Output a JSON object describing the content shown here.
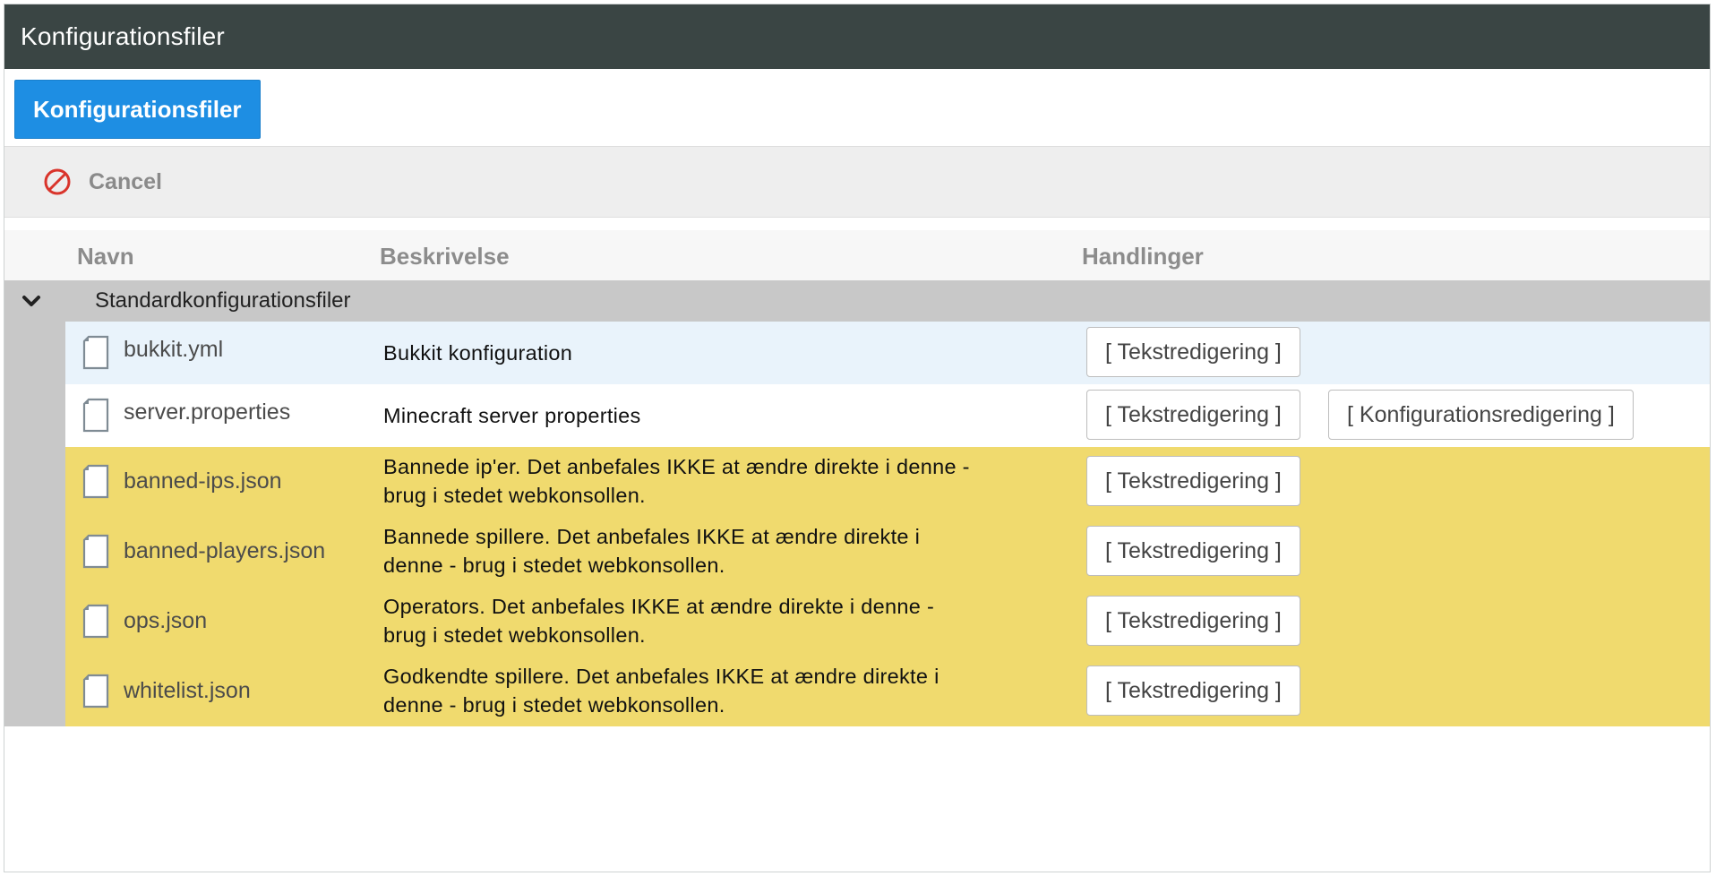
{
  "window": {
    "title": "Konfigurationsfiler"
  },
  "tab": {
    "label": "Konfigurationsfiler"
  },
  "toolbar": {
    "cancel_label": "Cancel"
  },
  "table": {
    "headers": {
      "name": "Navn",
      "description": "Beskrivelse",
      "actions": "Handlinger"
    },
    "group": {
      "label": "Standardkonfigurationsfiler",
      "rows": [
        {
          "name": "bukkit.yml",
          "description": "Bukkit konfiguration",
          "actions": [
            "[ Tekstredigering ]"
          ]
        },
        {
          "name": "server.properties",
          "description": "Minecraft server properties",
          "actions": [
            "[ Tekstredigering ]",
            "[ Konfigurationsredigering ]"
          ]
        },
        {
          "name": "banned-ips.json",
          "description_line1": "Bannede ip'er. Det anbefales IKKE at ændre direkte i denne -",
          "description_line2": "brug i stedet webkonsollen.",
          "actions": [
            "[ Tekstredigering ]"
          ]
        },
        {
          "name": "banned-players.json",
          "description_line1": "Bannede spillere. Det anbefales IKKE at ændre direkte i",
          "description_line2": "denne - brug i stedet webkonsollen.",
          "actions": [
            "[ Tekstredigering ]"
          ]
        },
        {
          "name": "ops.json",
          "description_line1": "Operators. Det anbefales IKKE at ændre direkte i denne -",
          "description_line2": "brug i stedet webkonsollen.",
          "actions": [
            "[ Tekstredigering ]"
          ]
        },
        {
          "name": "whitelist.json",
          "description_line1": "Godkendte spillere. Det anbefales IKKE at ændre direkte i",
          "description_line2": "denne - brug i stedet webkonsollen.",
          "actions": [
            "[ Tekstredigering ]"
          ]
        }
      ]
    }
  },
  "colors": {
    "titlebar": "#3a4544",
    "accent": "#1e8ee3",
    "row_selected": "#e9f3fb",
    "row_warning": "#f0da6e",
    "group": "#c8c8c8",
    "cancel_icon": "#d9342b"
  },
  "icons": {
    "cancel": "cancel-icon",
    "chevron": "chevron-down-icon",
    "file": "file-icon"
  }
}
